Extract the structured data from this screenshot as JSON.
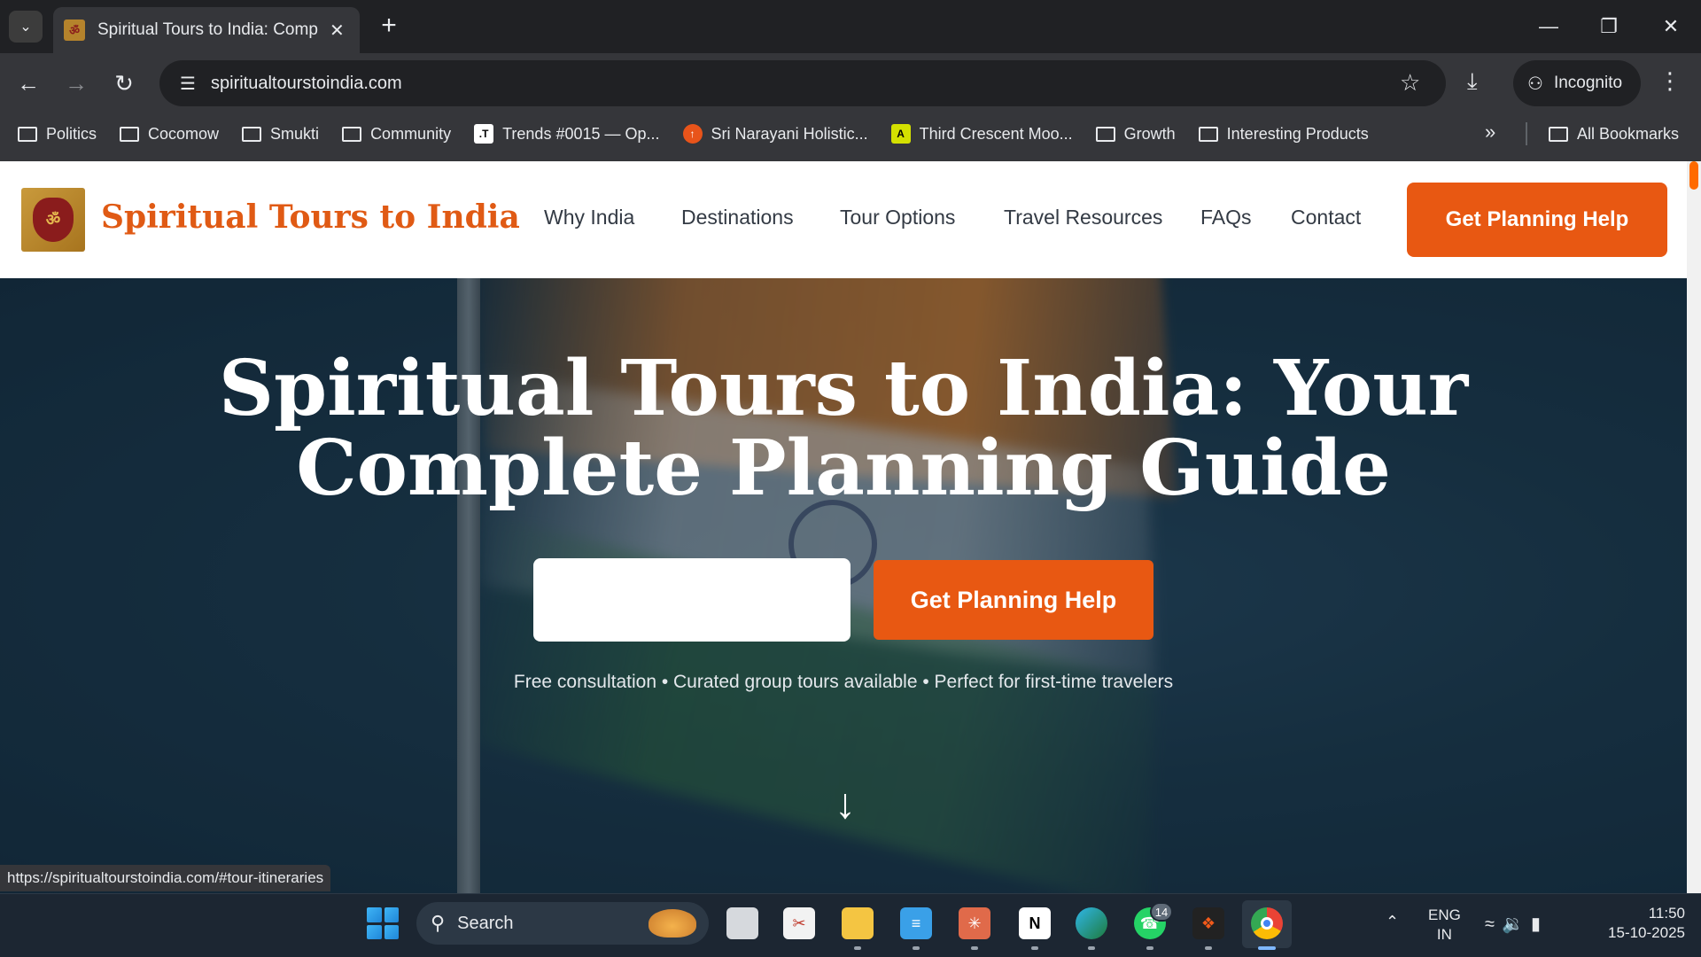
{
  "browser": {
    "tab_title": "Spiritual Tours to India: Comple",
    "new_tab_symbol": "+",
    "url": "spiritualtourstoindia.com",
    "profile_label": "Incognito",
    "status_url": "https://spiritualtourstoindia.com/#tour-itineraries",
    "bookmarks": [
      {
        "label": "Politics",
        "icon": "folder-icon"
      },
      {
        "label": "Cocomow",
        "icon": "folder-icon"
      },
      {
        "label": "Smukti",
        "icon": "folder-icon"
      },
      {
        "label": "Community",
        "icon": "folder-icon"
      },
      {
        "label": "Trends #0015 — Op...",
        "icon": "trends-favicon"
      },
      {
        "label": "Sri Narayani Holistic...",
        "icon": "narayani-favicon"
      },
      {
        "label": "Third Crescent Moo...",
        "icon": "crescent-favicon"
      },
      {
        "label": "Growth",
        "icon": "folder-icon"
      },
      {
        "label": "Interesting Products",
        "icon": "folder-icon"
      }
    ],
    "all_bookmarks_label": "All Bookmarks"
  },
  "site": {
    "name": "Spiritual Tours to India",
    "logo_glyph": "ॐ",
    "nav": [
      "Why India",
      "Destinations",
      "Tour Options",
      "Travel Resources",
      "FAQs",
      "Contact"
    ],
    "header_cta": "Get Planning Help",
    "accent_color": "#e85812"
  },
  "hero": {
    "title": "Spiritual Tours to India: Your Complete Planning Guide",
    "input_value": "",
    "cta": "Get Planning Help",
    "subtitle": "Free consultation • Curated group tours available • Perfect for first-time travelers",
    "scroll_icon": "arrow-down-icon"
  },
  "taskbar": {
    "search_label": "Search",
    "whatsapp_badge": "14",
    "language_line1": "ENG",
    "language_line2": "IN",
    "time": "11:50",
    "date": "15-10-2025"
  }
}
